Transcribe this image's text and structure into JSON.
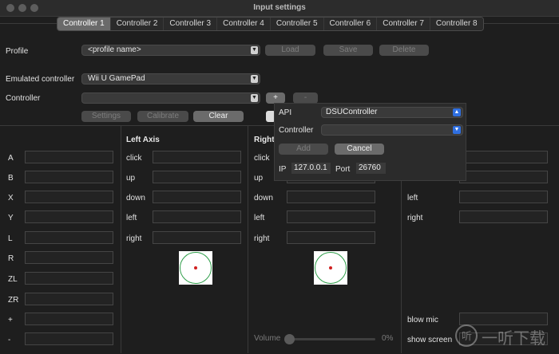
{
  "window": {
    "title": "Input settings"
  },
  "tabs": [
    "Controller 1",
    "Controller 2",
    "Controller 3",
    "Controller 4",
    "Controller 5",
    "Controller 6",
    "Controller 7",
    "Controller 8"
  ],
  "profile": {
    "label": "Profile",
    "value": "<profile name>",
    "load": "Load",
    "save": "Save",
    "delete": "Delete"
  },
  "emulated": {
    "label": "Emulated controller",
    "value": "Wii U GamePad"
  },
  "controller": {
    "label": "Controller",
    "value": "",
    "add": "+",
    "remove": "-",
    "settings": "Settings",
    "calibrate": "Calibrate",
    "clear": "Clear"
  },
  "buttons": [
    "A",
    "B",
    "X",
    "Y",
    "L",
    "R",
    "ZL",
    "ZR",
    "+",
    "-"
  ],
  "left_axis": {
    "title": "Left Axis",
    "rows": [
      "click",
      "up",
      "down",
      "left",
      "right"
    ]
  },
  "right_axis": {
    "title": "Right",
    "rows": [
      "click",
      "up",
      "down",
      "left",
      "right"
    ]
  },
  "extra": {
    "rows": [
      "down",
      "left",
      "right"
    ],
    "blow_mic": "blow mic",
    "show_screen": "show screen"
  },
  "volume": {
    "label": "Volume",
    "value": "0%"
  },
  "popup": {
    "api_label": "API",
    "api_value": "DSUController",
    "controller_label": "Controller",
    "controller_value": "",
    "add": "Add",
    "cancel": "Cancel",
    "ip_label": "IP",
    "ip_value": "127.0.0.1",
    "port_label": "Port",
    "port_value": "26760"
  },
  "colors": {
    "accent": "#2f6fe0",
    "ring": "#2f9e4a",
    "dot": "#d02020"
  },
  "watermark": {
    "text": "一听下载"
  }
}
